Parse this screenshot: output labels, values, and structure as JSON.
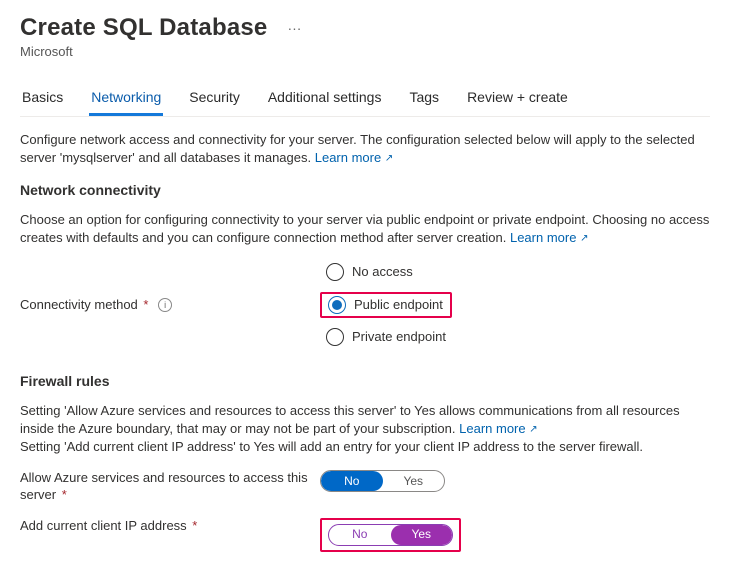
{
  "header": {
    "title": "Create SQL Database",
    "publisher": "Microsoft"
  },
  "tabs": {
    "items": [
      {
        "label": "Basics"
      },
      {
        "label": "Networking"
      },
      {
        "label": "Security"
      },
      {
        "label": "Additional settings"
      },
      {
        "label": "Tags"
      },
      {
        "label": "Review + create"
      }
    ],
    "activeIndex": 1
  },
  "intro": {
    "text": "Configure network access and connectivity for your server. The configuration selected below will apply to the selected server 'mysqlserver' and all databases it manages.",
    "learn": "Learn more"
  },
  "connectivity": {
    "section_title": "Network connectivity",
    "desc": "Choose an option for configuring connectivity to your server via public endpoint or private endpoint. Choosing no access creates with defaults and you can configure connection method after server creation.",
    "learn": "Learn more",
    "label": "Connectivity method",
    "options": [
      {
        "label": "No access",
        "selected": false,
        "highlight": false
      },
      {
        "label": "Public endpoint",
        "selected": true,
        "highlight": true
      },
      {
        "label": "Private endpoint",
        "selected": false,
        "highlight": false
      }
    ]
  },
  "firewall": {
    "section_title": "Firewall rules",
    "desc1": "Setting 'Allow Azure services and resources to access this server' to Yes allows communications from all resources inside the Azure boundary, that may or may not be part of your subscription.",
    "learn": "Learn more",
    "desc2": "Setting 'Add current client IP address' to Yes will add an entry for your client IP address to the server firewall.",
    "rows": [
      {
        "label": "Allow Azure services and resources to access this server",
        "value": "No",
        "no_label": "No",
        "yes_label": "Yes",
        "highlight": false
      },
      {
        "label": "Add current client IP address",
        "value": "Yes",
        "no_label": "No",
        "yes_label": "Yes",
        "highlight": true
      }
    ]
  }
}
